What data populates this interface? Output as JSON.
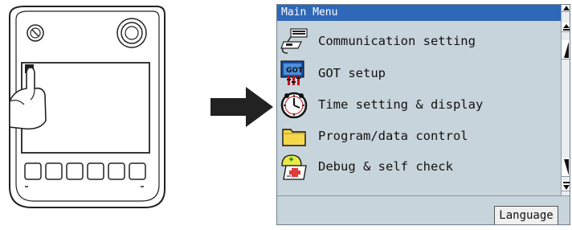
{
  "screen": {
    "title": "Main Menu",
    "items": [
      {
        "label": "Communication setting",
        "icon": "communication-icon"
      },
      {
        "label": "GOT setup",
        "icon": "got-setup-icon"
      },
      {
        "label": "Time setting & display",
        "icon": "clock-icon"
      },
      {
        "label": "Program/data control",
        "icon": "folder-icon"
      },
      {
        "label": "Debug & self check",
        "icon": "debug-icon"
      }
    ],
    "language_button": "Language"
  },
  "colors": {
    "titlebar": "#2f68b8",
    "screen_bg": "#c8d4dc"
  }
}
